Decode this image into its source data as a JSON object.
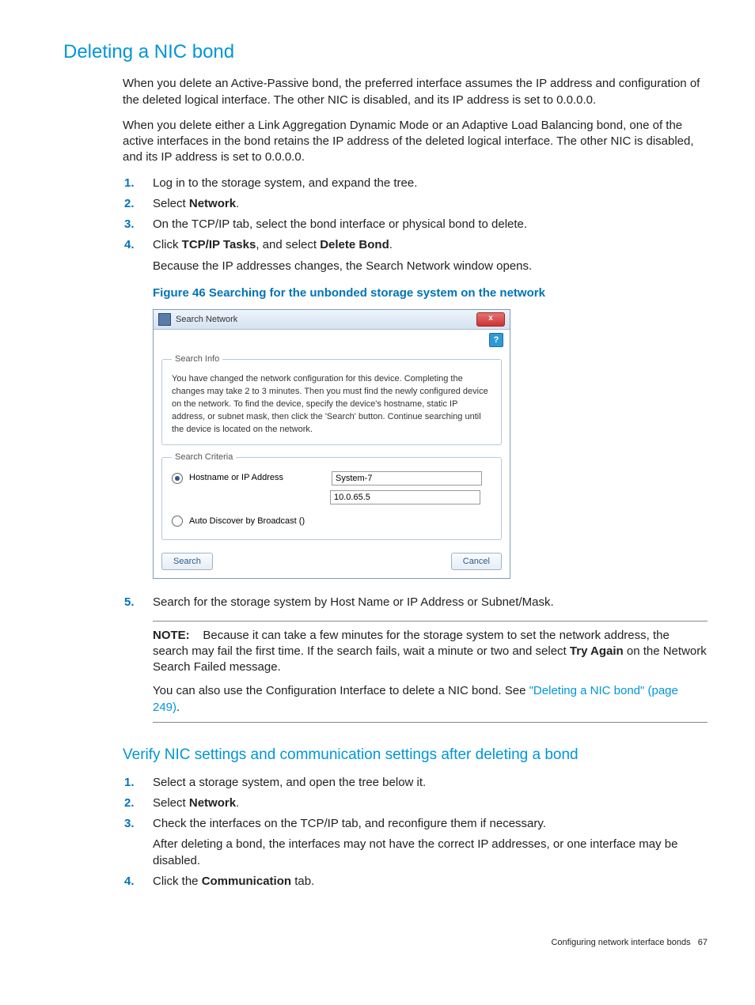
{
  "h1": "Deleting a NIC bond",
  "p1": "When you delete an Active-Passive bond, the preferred interface assumes the IP address and configuration of the deleted logical interface. The other NIC is disabled, and its IP address is set to 0.0.0.0.",
  "p2": "When you delete either a Link Aggregation Dynamic Mode or an Adaptive Load Balancing bond, one of the active interfaces in the bond retains the IP address of the deleted logical interface. The other NIC is disabled, and its IP address is set to 0.0.0.0.",
  "steps1": {
    "s1": "Log in to the storage system, and expand the tree.",
    "s2_pre": "Select ",
    "s2_bold": "Network",
    "s2_post": ".",
    "s3": "On the TCP/IP tab, select the bond interface or physical bond to delete.",
    "s4_pre": "Click ",
    "s4_b1": "TCP/IP Tasks",
    "s4_mid": ", and select ",
    "s4_b2": "Delete Bond",
    "s4_post": ".",
    "s4_sub": "Because the IP addresses changes, the Search Network window opens.",
    "s5": "Search for the storage system by Host Name or IP Address or Subnet/Mask."
  },
  "fig_caption": "Figure 46 Searching for the unbonded storage system on the network",
  "dialog": {
    "title": "Search Network",
    "close": "x",
    "help": "?",
    "info_legend": "Search Info",
    "info_text": "You have changed the network configuration for this device. Completing the changes may take 2 to 3 minutes. Then you must find the newly configured device on the network. To find the device, specify the device's hostname, static IP address, or subnet mask, then click the 'Search' button. Continue searching until the device is located on the network.",
    "criteria_legend": "Search Criteria",
    "radio1_label": "Hostname or IP Address",
    "field_host": "System-7",
    "field_ip": "10.0.65.5",
    "radio2_label": "Auto Discover by Broadcast ()",
    "btn_search": "Search",
    "btn_cancel": "Cancel"
  },
  "note": {
    "label": "NOTE:",
    "t1_pre": "Because it can take a few minutes for the storage system to set the network address, the search may fail the first time. If the search fails, wait a minute or two and select ",
    "t1_bold": "Try Again",
    "t1_post": " on the Network Search Failed message.",
    "t2_pre": "You can also use the Configuration Interface to delete a NIC bond. See ",
    "t2_link": "\"Deleting a NIC bond\" (page 249)",
    "t2_post": "."
  },
  "h2": "Verify NIC settings and communication settings after deleting a bond",
  "steps2": {
    "s1": "Select a storage system, and open the tree below it.",
    "s2_pre": "Select ",
    "s2_bold": "Network",
    "s2_post": ".",
    "s3": "Check the interfaces on the TCP/IP tab, and reconfigure them if necessary.",
    "s3_sub": "After deleting a bond, the interfaces may not have the correct IP addresses, or one interface may be disabled.",
    "s4_pre": "Click the ",
    "s4_bold": "Communication",
    "s4_post": " tab."
  },
  "footer": {
    "text": "Configuring network interface bonds",
    "page": "67"
  }
}
